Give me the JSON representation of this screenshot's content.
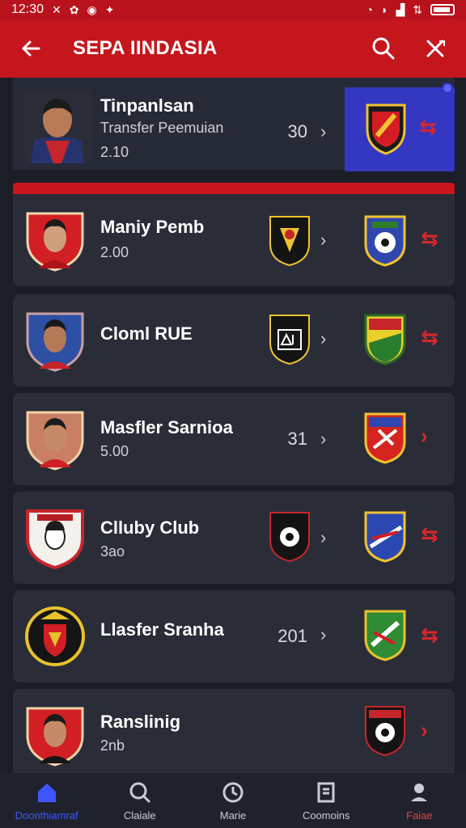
{
  "status_bar": {
    "time": "12:30"
  },
  "header": {
    "title": "SEPA IINDASIA"
  },
  "rows": [
    {
      "name": "Tinpanlsan",
      "subtitle": "Transfer Peemuian",
      "value": "2.10",
      "score": "30"
    },
    {
      "name": "Maniy Pemb",
      "value": "2.00"
    },
    {
      "name": "Cloml RUE"
    },
    {
      "name": "Masfler Sarnioa",
      "value": "5.00",
      "score": "31"
    },
    {
      "name": "Clluby Club",
      "value": "3ao"
    },
    {
      "name": "Llasfer Sranha",
      "score": "201"
    },
    {
      "name": "Ranslinig",
      "value": "2nb"
    }
  ],
  "nav": [
    {
      "label": "Doonthiamraf"
    },
    {
      "label": "Claiale"
    },
    {
      "label": "Marie"
    },
    {
      "label": "Coomoins"
    },
    {
      "label": "Faiae"
    }
  ],
  "colors": {
    "app_bar": "#c5161d",
    "background": "#1b1e27",
    "card": "#2a2d38",
    "highlight_card": "#3337c2",
    "nav_active": "#3e56ff",
    "accent_red": "#d8262c"
  }
}
